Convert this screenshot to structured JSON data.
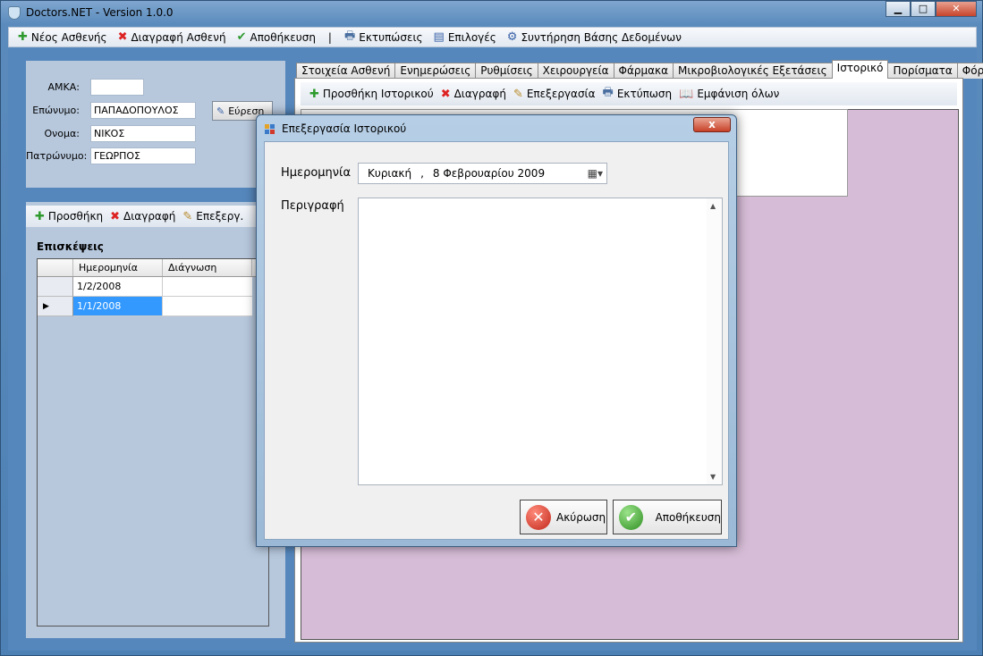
{
  "window": {
    "title": "Doctors.NET - Version 1.0.0",
    "min": "▁",
    "max": "□",
    "close": "✕"
  },
  "menubar": {
    "items": [
      {
        "label": "Νέος Ασθενής",
        "icon": "plus-icon"
      },
      {
        "label": "Διαγραφή Ασθενή",
        "icon": "delete-icon"
      },
      {
        "label": "Αποθήκευση",
        "icon": "check-icon"
      },
      {
        "label": "|",
        "icon": ""
      },
      {
        "label": "Εκτυπώσεις",
        "icon": "printer-icon"
      },
      {
        "label": "Επιλογές",
        "icon": "options-icon"
      },
      {
        "label": "Συντήρηση Βάσης Δεδομένων",
        "icon": "gear-icon"
      }
    ]
  },
  "search": {
    "amka_label": "ΑΜΚΑ:",
    "amka_value": "",
    "surname_label": "Επώνυμο:",
    "surname_value": "ΠΑΠΑΔΟΠΟΥΛΟΣ",
    "name_label": "Ονομα:",
    "name_value": "ΝΙΚΟΣ",
    "father_label": "Πατρώνυμο:",
    "father_value": "ΓΕΩΡΠΟΣ",
    "find_label": "Εύρεση"
  },
  "visits": {
    "toolbar": {
      "add": "Προσθήκη",
      "delete": "Διαγραφή",
      "edit": "Επεξεργ."
    },
    "title": "Επισκέψεις",
    "columns": [
      "Ημερομηνία",
      "Διάγνωση"
    ],
    "rows": [
      {
        "date": "1/2/2008",
        "diagnosis": "",
        "selected": false
      },
      {
        "date": "1/1/2008",
        "diagnosis": "",
        "selected": true
      }
    ],
    "row_indicator": "▶"
  },
  "tabs": [
    {
      "label": "Στοιχεία Ασθενή",
      "active": false
    },
    {
      "label": "Ενημερώσεις",
      "active": false
    },
    {
      "label": "Ρυθμίσεις",
      "active": false
    },
    {
      "label": "Χειρουργεία",
      "active": false
    },
    {
      "label": "Φάρμακα",
      "active": false
    },
    {
      "label": "Μικροβιολογικές Εξετάσεις",
      "active": false
    },
    {
      "label": "Ιστορικό",
      "active": true
    },
    {
      "label": "Πορίσματα",
      "active": false
    },
    {
      "label": "Φόρμες",
      "active": false
    }
  ],
  "history_toolbar": {
    "add": "Προσθήκη Ιστορικού",
    "delete": "Διαγραφή",
    "edit": "Επεξεργασία",
    "print": "Εκτύπωση",
    "show_all": "Εμφάνιση όλων"
  },
  "dialog": {
    "title": "Επεξεργασία Ιστορικού",
    "close": "x",
    "date_label": "Ημερομηνία",
    "date_day": "Κυριακή",
    "date_sep": ",",
    "date_value": "8 Φεβρουαρίου 2009",
    "description_label": "Περιγραφή",
    "description_value": "",
    "cancel_label": "Ακύρωση",
    "save_label": "Αποθήκευση"
  },
  "colors": {
    "frame": "#4a7db3",
    "panel": "#b7c8dd",
    "lilac": "#d6bcd6",
    "selection": "#3399ff",
    "cancel": "#d12f20",
    "save": "#3aa12c"
  }
}
